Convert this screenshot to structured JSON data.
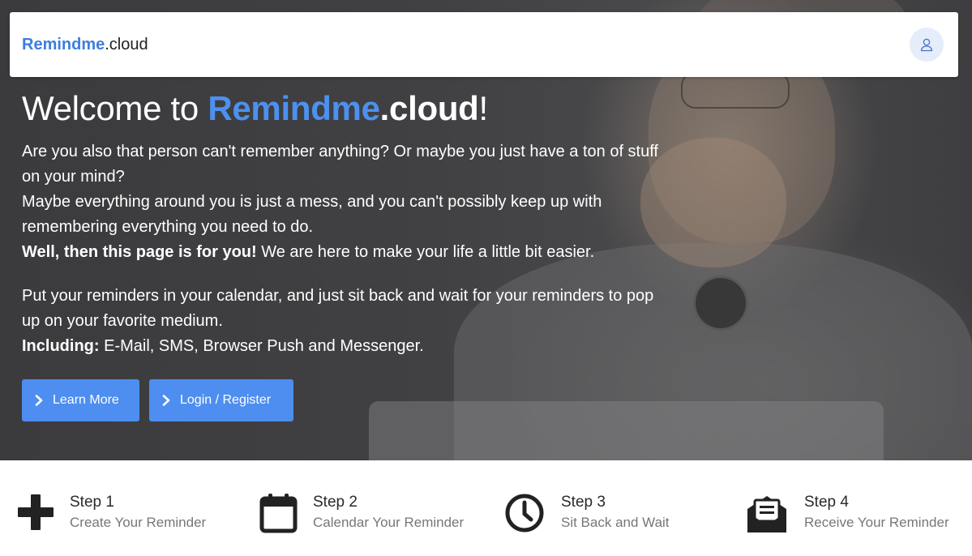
{
  "navbar": {
    "brand_primary": "Remindme",
    "brand_secondary": ".cloud",
    "avatar_icon": "user-icon"
  },
  "hero": {
    "title_prefix": "Welcome to ",
    "title_brand": "Remindme",
    "title_brand_suffix": ".cloud",
    "title_end": "!",
    "intro_line1": "Are you also that person can't remember anything? Or maybe you just have a ton of stuff on your mind?",
    "intro_line2": "Maybe everything around you is just a mess, and you can't possibly keep up with remembering everything you need to do.",
    "intro_bold": "Well, then this page is for you!",
    "intro_rest": " We are here to make your life a little bit easier.",
    "calendar_line": "Put your reminders in your calendar, and just sit back and wait for your reminders to pop up on your favorite medium.",
    "including_label": "Including:",
    "including_text": " E-Mail, SMS, Browser Push and Messenger.",
    "buttons": {
      "learn_more": "Learn More",
      "login_register": "Login / Register"
    }
  },
  "steps": [
    {
      "title": "Step 1",
      "subtitle": "Create Your Reminder",
      "icon": "plus-icon"
    },
    {
      "title": "Step 2",
      "subtitle": "Calendar Your Reminder",
      "icon": "calendar-icon"
    },
    {
      "title": "Step 3",
      "subtitle": "Sit Back and Wait",
      "icon": "clock-icon"
    },
    {
      "title": "Step 4",
      "subtitle": "Receive Your Reminder",
      "icon": "envelope-open-icon"
    }
  ],
  "colors": {
    "accent": "#4d8ef0",
    "brand_blue": "#3d7de0",
    "hero_overlay": "#3e3e40"
  }
}
